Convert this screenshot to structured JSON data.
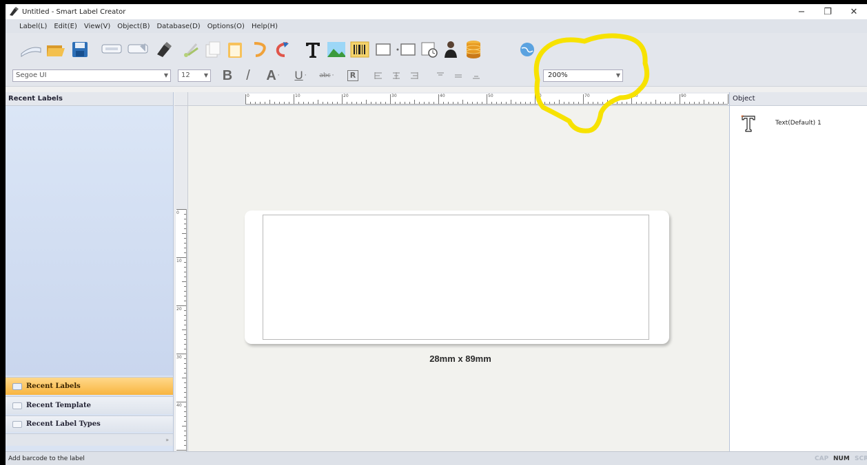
{
  "window": {
    "title": "Untitled - Smart Label Creator",
    "controls": {
      "minimize": "−",
      "maximize": "❐",
      "close": "✕"
    }
  },
  "menu": [
    "Label(L)",
    "Edit(E)",
    "View(V)",
    "Object(B)",
    "Database(D)",
    "Options(O)",
    "Help(H)"
  ],
  "toolbar": {
    "icons": [
      "new-label-icon",
      "open-folder-icon",
      "save-icon",
      "print-preview-icon",
      "print-icon",
      "clear-icon",
      "cut-icon",
      "copy-icon",
      "paste-icon",
      "undo-icon",
      "redo-icon",
      "text-tool-icon",
      "image-tool-icon",
      "barcode-tool-icon",
      "rectangle-tool-icon",
      "shape-tool-icon",
      "date-time-tool-icon",
      "person-tool-icon",
      "database-icon",
      "globe-icon"
    ]
  },
  "format": {
    "font": "Segoe UI",
    "size": "12",
    "bold": "B",
    "italic": "/",
    "font_color": "A",
    "underline": "U",
    "strike": "abc",
    "frame": "R",
    "zoom": "200%"
  },
  "ruler": {
    "top_ticks": [
      "0",
      "10",
      "20",
      "30",
      "40",
      "50",
      "60",
      "70",
      "80",
      "90"
    ],
    "left_ticks": [
      "0",
      "10",
      "20",
      "30",
      "40"
    ]
  },
  "left_panel": {
    "header": "Recent Labels",
    "nav": [
      "Recent Labels",
      "Recent Template",
      "Recent Label Types"
    ],
    "active": 0
  },
  "canvas": {
    "label_size": "28mm x 89mm"
  },
  "right_panel": {
    "header": "Object",
    "objects": [
      {
        "name": "Text(Default) 1",
        "icon": "text-object-icon"
      }
    ]
  },
  "status": {
    "message": "Add barcode to the label",
    "indicators": [
      "CAP",
      "NUM",
      "SCR"
    ]
  },
  "colors": {
    "accent_active_nav": "#f8b540",
    "annotation": "#f7e200",
    "panel_bg": "#d9e3f3"
  }
}
